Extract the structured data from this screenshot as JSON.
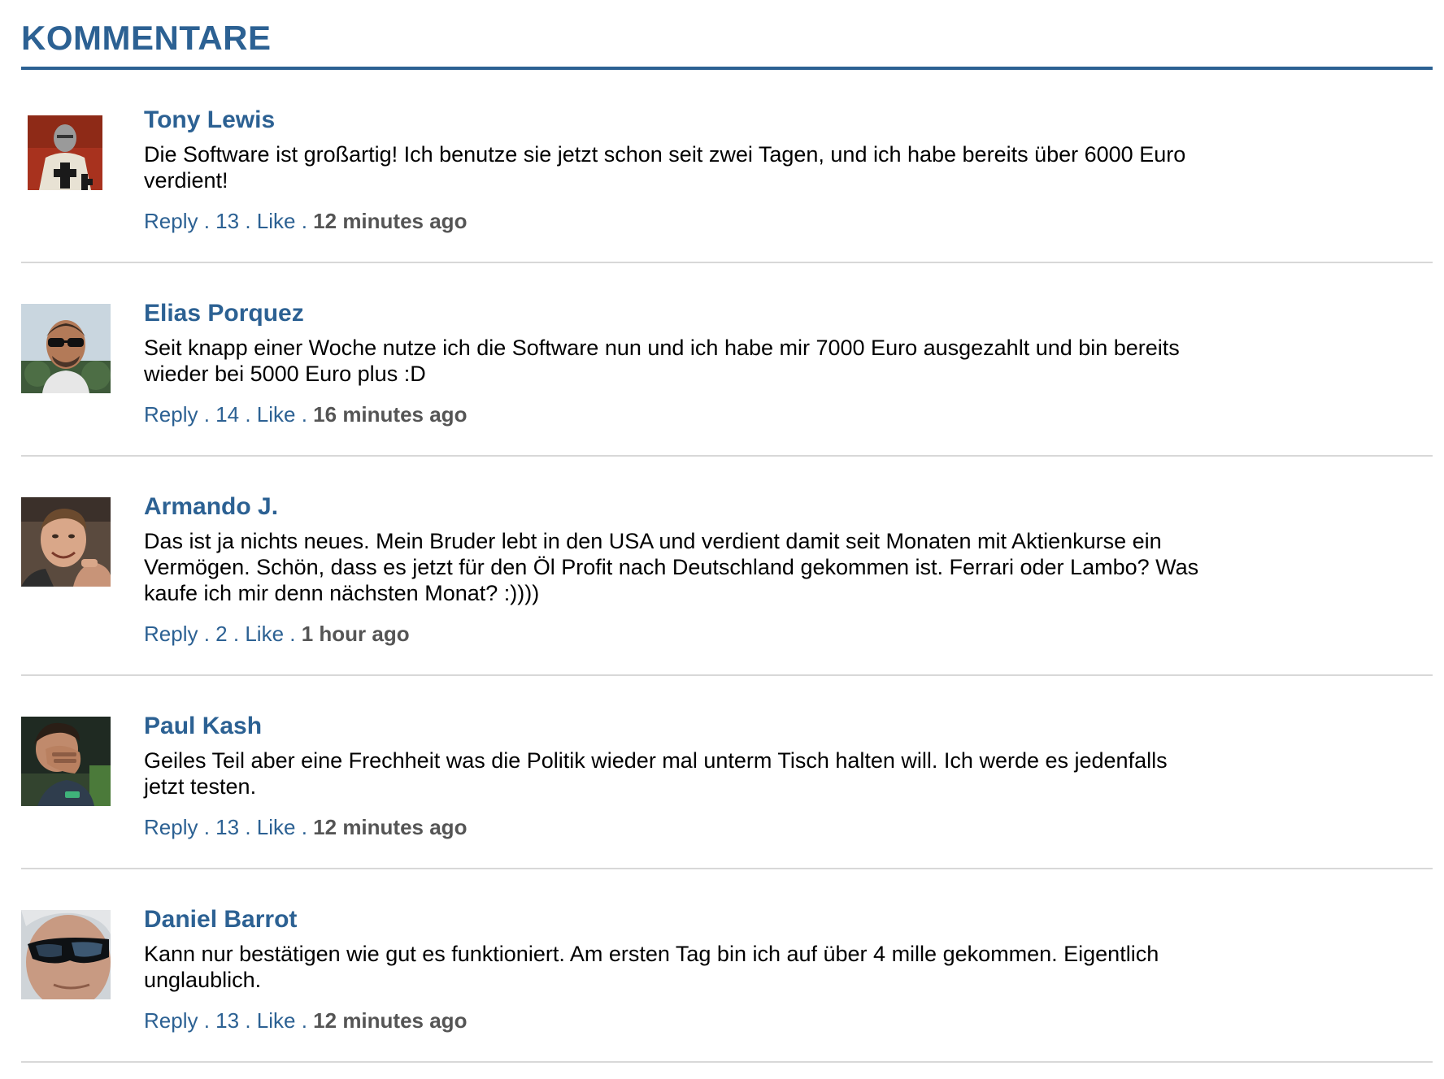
{
  "section": {
    "title": "KOMMENTARE"
  },
  "comments": [
    {
      "author": "Tony Lewis",
      "text": "Die Software ist großartig! Ich benutze sie jetzt schon seit zwei Tagen, und ich habe bereits über 6000 Euro verdient!",
      "reply_label": "Reply",
      "likes": "13",
      "like_label": "Like",
      "time": "12 minutes ago",
      "avatar_icon": "knight-avatar"
    },
    {
      "author": "Elias Porquez",
      "text": "Seit knapp einer Woche nutze ich die Software nun und ich habe mir 7000 Euro ausgezahlt und bin bereits wieder bei 5000 Euro plus :D",
      "reply_label": "Reply",
      "likes": "14",
      "like_label": "Like",
      "time": "16 minutes ago",
      "avatar_icon": "sunglasses-man-avatar"
    },
    {
      "author": "Armando J.",
      "text": "Das ist ja nichts neues. Mein Bruder lebt in den USA und verdient damit seit Monaten mit Aktienkurse ein Vermögen. Schön, dass es jetzt für den Öl Profit nach Deutschland gekommen ist. Ferrari oder Lambo? Was kaufe ich mir denn nächsten Monat? :))))",
      "reply_label": "Reply",
      "likes": "2",
      "like_label": "Like",
      "time": "1 hour ago",
      "avatar_icon": "smiling-man-avatar"
    },
    {
      "author": "Paul Kash",
      "text": "Geiles Teil aber eine Frechheit was die Politik wieder mal unterm Tisch halten will. Ich werde es jedenfalls jetzt testen.",
      "reply_label": "Reply",
      "likes": "13",
      "like_label": "Like",
      "time": "12 minutes ago",
      "avatar_icon": "facepalm-man-avatar"
    },
    {
      "author": "Daniel Barrot",
      "text": "Kann nur bestätigen wie gut es funktioniert. Am ersten Tag bin ich auf über 4 mille gekommen. Eigentlich unglaublich.",
      "reply_label": "Reply",
      "likes": "13",
      "like_label": "Like",
      "time": "12 minutes ago",
      "avatar_icon": "sunglasses-closeup-avatar"
    }
  ],
  "colors": {
    "accent": "#2c6193",
    "divider": "#d8d8d8",
    "meta_time": "#555555"
  }
}
